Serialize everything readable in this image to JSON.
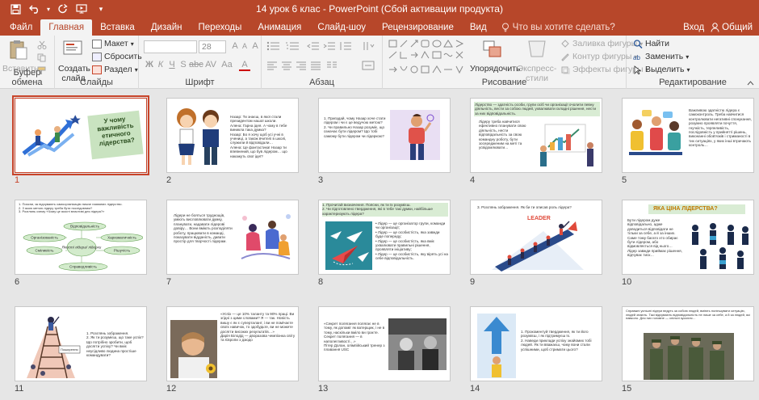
{
  "titlebar": {
    "title": "14 урок 6 клас - PowerPoint (Сбой активации продукта)",
    "qat": [
      "save-icon",
      "undo-icon",
      "redo-icon",
      "start-from-beginning-icon",
      "customize-qat-icon"
    ]
  },
  "tabs": [
    "Файл",
    "Главная",
    "Вставка",
    "Дизайн",
    "Переходы",
    "Анимация",
    "Слайд-шоу",
    "Рецензирование",
    "Вид"
  ],
  "active_tab": "Главная",
  "tell_me": "Что вы хотите сделать?",
  "account": {
    "signin": "Вход",
    "share": "Общий"
  },
  "ribbon": {
    "clipboard": {
      "paste": "Вставить",
      "label": "Буфер обмена"
    },
    "slides": {
      "new_slide": "Создать слайд",
      "layout": "Макет",
      "reset": "Сбросить",
      "section": "Раздел",
      "label": "Слайды"
    },
    "font": {
      "font_size": "28",
      "label": "Шрифт"
    },
    "paragraph": {
      "label": "Абзац"
    },
    "drawing": {
      "arrange": "Упорядочить",
      "quick_styles": "Экспресс-стили",
      "shape_fill": "Заливка фигуры",
      "shape_outline": "Контур фигуры",
      "shape_effects": "Эффекты фигуры",
      "label": "Рисование"
    },
    "editing": {
      "find": "Найти",
      "replace": "Заменить",
      "select": "Выделить",
      "label": "Редактирование"
    }
  },
  "slides": [
    {
      "num": "1",
      "selected": true,
      "title": "У чому важливість етичного лідерства?"
    },
    {
      "num": "2",
      "text": "Назар: Ти знаєш, в якої стали президентом нашої школи.\nАлена: Гарна ідея. А чому в тебе виникла така думка?\nНазар: Бо я хочу щоб усі учні в учениці, а також вчителі в школі, служили й відповідали…\nАлена: Це фантастика! Назар ти впевнений, що був лідером… що накажуть свої ідеї?"
    },
    {
      "num": "3",
      "text": "1. Пригадай, чому Назар хоче стати лідером і чи є це ведучою метою?\n2. Чи правильно Назар розуміє, що означає бути лідером? Що тобі самому бути лідером чи лідеркою?"
    },
    {
      "num": "4",
      "header": "Лідерство — здатність особи, групи осіб чи організації очолити певну діяльність, вести за собою людей, ухвалювати складні рішення, нести за них відповідальність.",
      "text": "Лідеру треба навчитися ефективно планувати свою діяльність, нести відповідальність за свою командну роботу, бути зосередженим на меті та усвідомлювати…"
    },
    {
      "num": "5",
      "text": "Важливою здатністю лідера є самоконтроль. Треба навчитися контролювати негативні спонукання, розумно проявляти почуття, гнучкість, терпеливість, послідовність у прийнятті рішень, виконанні обов'язків і стриманості в тих ситуаціях, у яких інші втрачають контроль…"
    },
    {
      "num": "6",
      "text": "1. Поясни, як відчувають самоорганізацію нижче названих лідерство.\n2. З якою метою лідеру треба бути послідовним?\n3. Розглянь схему «Чому це якості властиві для лідера?»",
      "scheme": [
        "Відповідальність",
        "Організованість",
        "Якості лідера/ лідерки",
        "Харизматичність",
        "Сміливість",
        "Рішучість",
        "Справедливість"
      ]
    },
    {
      "num": "7",
      "text": "Лідери не бояться труднощів, уміють висловлювати думку, планувати, надавати лідерові довіру… Вони вміють розподіляти роботу, працювати в команді, показувати відданість, давати простір для творчості лідерам."
    },
    {
      "num": "8",
      "header": "1. Прочитай визначення. Поясни, як ти їх розумієш.\n2. Чи підготовлено твердження, які в тебе такі думки, найбільше характеризують лідера?",
      "text": "• Лідер — це організатор групи, команди чи організації;\n• Лідер — це особистість, яка завжди буде попереду;\n• Лідер — це особистість, яка вміє ухвалювати правильні рішення, проявляти ініціативу;\n• Лідер — це особистість, яку вірять усі на себе відповідальність."
    },
    {
      "num": "9",
      "text": "3. Розглянь зображення. Як би ти описав роль лідера?",
      "label": "LEADER"
    },
    {
      "num": "10",
      "header": "ЯКА ЦІНА ЛІДЕРСТВА?",
      "text": "Бути лідером дуже відповідально, адже доводиться відповідати не тільки за себе, а й за інших. Саме тому багато хто обирає бути лідером, або відмовляється від нього… Лідер завжди приймає рішення, відчуває тиск…"
    },
    {
      "num": "11",
      "text": "1. Розглянь зображення.\n2. Як ти розумієш, що таке успіх? Що потрібно зробити, щоб досягти успіху? Чи вміє неусідливо людина простіше командувати?"
    },
    {
      "num": "12",
      "text": "«Успіх — це 10% таланту та 90% праці. Ви згідні з цими словами? Я — так. Новість вишу є як є суперталант, і ви не помічаєте своїх навичок, то здобудьте, ви не можете досягти високих результатів…»\nДарія Білодід — дворазова чемпіонка світу та Європи з дзюдо"
    },
    {
      "num": "13",
      "text": "«Секрет полягання полягає не в тому, як допоміг як ватерщик, і не в тому, наскільки вміло ви граєте. Секрет полягання — в наполегливості…»\nПітер Долан, олімпійський тренер з плавання USC"
    },
    {
      "num": "14",
      "text": "1. Прокоментуй твердження, як ти його розумієш, і як підтримуєш їх.\n2. Наведи приклади успіху знайомих тобі людей. Як ти вважаєш, чому вони стали успішними, щоб стримати цього?"
    },
    {
      "num": "15",
      "text": "Справжні успішні лідери ведуть за собою людей, вміють поліпшувати ситуацію, людей знають. Такі відчувають відповідальність не лише за себе, а й за людей, які навколо. Для них головне — спільні зусилля…"
    }
  ],
  "colors": {
    "brand": "#b7472a",
    "selected_outline": "#c8442a",
    "ribbon_bg": "#f3f3f3",
    "workspace_bg": "#e6e6e6"
  }
}
